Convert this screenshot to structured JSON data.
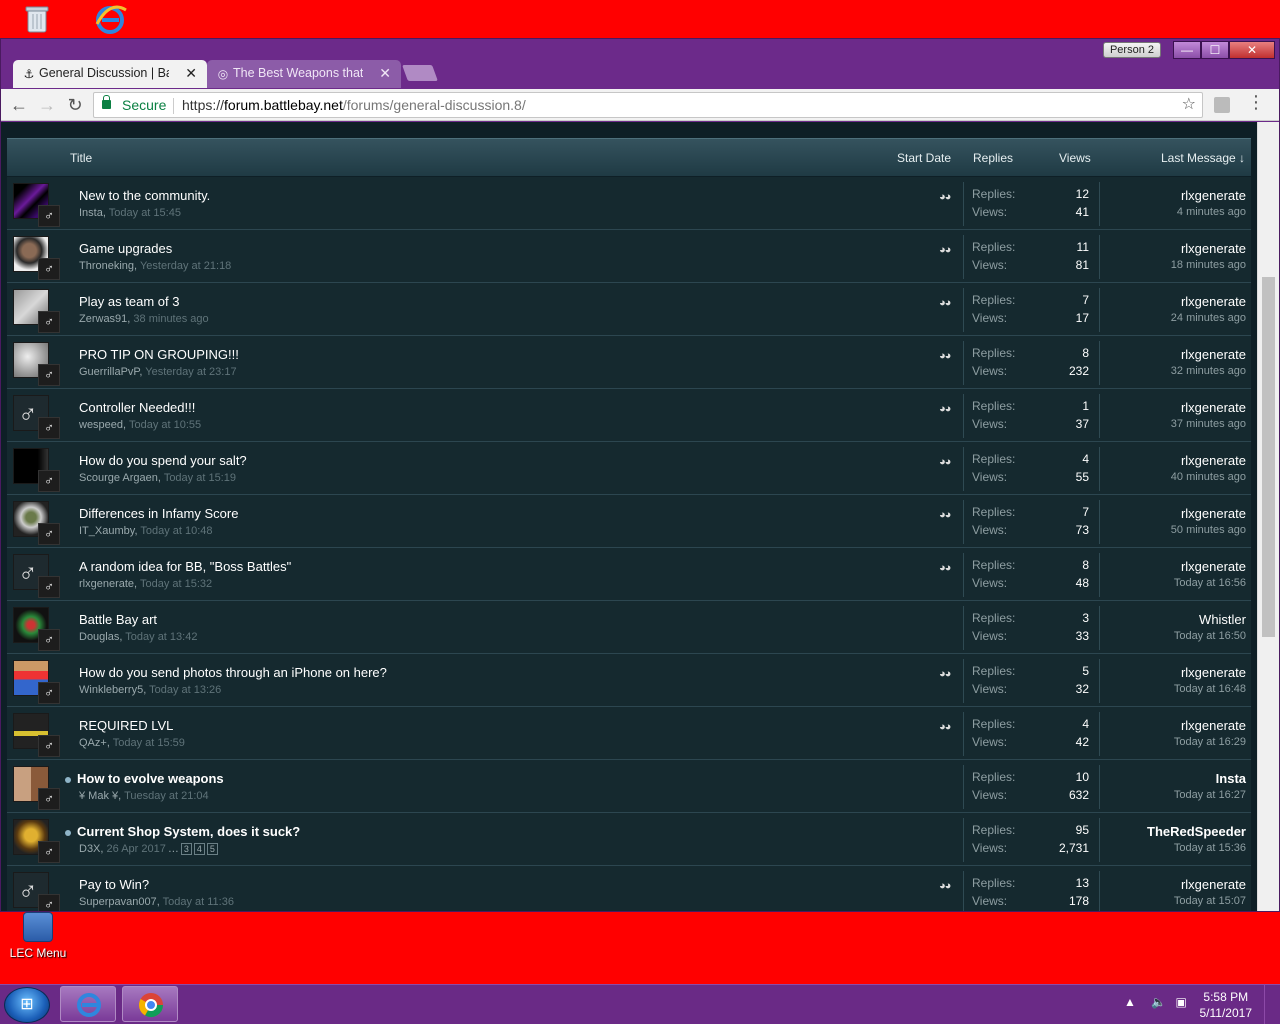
{
  "desktop": {
    "lec_menu_label": "LEC Menu"
  },
  "window": {
    "profile_button": "Person 2",
    "controls": {
      "minimize": "—",
      "maximize": "☐",
      "close": "✕"
    }
  },
  "tabs": [
    {
      "title": "General Discussion | Battl",
      "favicon": "ship-icon",
      "close": "✕"
    },
    {
      "title": "The Best Weapons that Y",
      "favicon": "globe-icon",
      "close": "✕"
    }
  ],
  "toolbar": {
    "secure_label": "Secure",
    "url_scheme": "https://",
    "url_host": "forum.battlebay.net",
    "url_path": "/forums/general-discussion.8/"
  },
  "thread_header": {
    "title": "Title",
    "start_date": "Start Date",
    "replies": "Replies",
    "views": "Views",
    "last_message": "Last Message ↓"
  },
  "stat_labels": {
    "replies": "Replies:",
    "views": "Views:"
  },
  "threads": [
    {
      "title": "New to the community.",
      "author": "Insta",
      "date": "Today at 15:45",
      "replies": "12",
      "views": "41",
      "last_user": "rlxgenerate",
      "last_time": "4 minutes ago",
      "avatar": "purple",
      "watched": true
    },
    {
      "title": "Game upgrades",
      "author": "Throneking",
      "date": "Yesterday at 21:18",
      "replies": "11",
      "views": "81",
      "last_user": "rlxgenerate",
      "last_time": "18 minutes ago",
      "avatar": "face",
      "watched": true
    },
    {
      "title": "Play as team of 3",
      "author": "Zerwas91",
      "date": "38 minutes ago",
      "replies": "7",
      "views": "17",
      "last_user": "rlxgenerate",
      "last_time": "24 minutes ago",
      "avatar": "grey",
      "watched": true
    },
    {
      "title": "PRO TIP ON GROUPING!!!",
      "author": "GuerrillaPvP",
      "date": "Yesterday at 23:17",
      "replies": "8",
      "views": "232",
      "last_user": "rlxgenerate",
      "last_time": "32 minutes ago",
      "avatar": "fog",
      "watched": true
    },
    {
      "title": "Controller Needed!!!",
      "author": "wespeed",
      "date": "Today at 10:55",
      "replies": "1",
      "views": "37",
      "last_user": "rlxgenerate",
      "last_time": "37 minutes ago",
      "avatar": "default",
      "watched": true
    },
    {
      "title": "How do you spend your salt?",
      "author": "Scourge Argaen",
      "date": "Today at 15:19",
      "replies": "4",
      "views": "55",
      "last_user": "rlxgenerate",
      "last_time": "40 minutes ago",
      "avatar": "dark",
      "watched": true
    },
    {
      "title": "Differences in Infamy Score",
      "author": "IT_Xaumby",
      "date": "Today at 10:48",
      "replies": "7",
      "views": "73",
      "last_user": "rlxgenerate",
      "last_time": "50 minutes ago",
      "avatar": "mask",
      "watched": true
    },
    {
      "title": "A random idea for BB, \"Boss Battles\"",
      "author": "rlxgenerate",
      "date": "Today at 15:32",
      "replies": "8",
      "views": "48",
      "last_user": "rlxgenerate",
      "last_time": "Today at 16:56",
      "avatar": "default",
      "watched": true
    },
    {
      "title": "Battle Bay art",
      "author": "Douglas",
      "date": "Today at 13:42",
      "replies": "3",
      "views": "33",
      "last_user": "Whistler",
      "last_time": "Today at 16:50",
      "avatar": "art",
      "watched": false
    },
    {
      "title": "How do you send photos through an iPhone on here?",
      "author": "Winkleberry5",
      "date": "Today at 13:26",
      "replies": "5",
      "views": "32",
      "last_user": "rlxgenerate",
      "last_time": "Today at 16:48",
      "avatar": "pixel",
      "watched": true
    },
    {
      "title": "REQUIRED LVL",
      "author": "QAz+",
      "date": "Today at 15:59",
      "replies": "4",
      "views": "42",
      "last_user": "rlxgenerate",
      "last_time": "Today at 16:29",
      "avatar": "boat",
      "watched": true
    },
    {
      "title": "How to evolve weapons",
      "author": "¥ Mak ¥",
      "date": "Tuesday at 21:04",
      "replies": "10",
      "views": "632",
      "last_user": "Insta",
      "last_time": "Today at 16:27",
      "avatar": "couple",
      "watched": false,
      "sticky": true
    },
    {
      "title": "Current Shop System, does it suck?",
      "author": "D3X",
      "date": "26 Apr 2017",
      "replies": "95",
      "views": "2,731",
      "last_user": "TheRedSpeeder",
      "last_time": "Today at 15:36",
      "avatar": "gold",
      "watched": false,
      "sticky": true,
      "pages": [
        "3",
        "4",
        "5"
      ],
      "pages_ellipsis": "…"
    },
    {
      "title": "Pay to Win?",
      "author": "Superpavan007",
      "date": "Today at 11:36",
      "replies": "13",
      "views": "178",
      "last_user": "rlxgenerate",
      "last_time": "Today at 15:07",
      "avatar": "default",
      "watched": true
    }
  ],
  "taskbar": {
    "time": "5:58 PM",
    "date": "5/11/2017"
  }
}
